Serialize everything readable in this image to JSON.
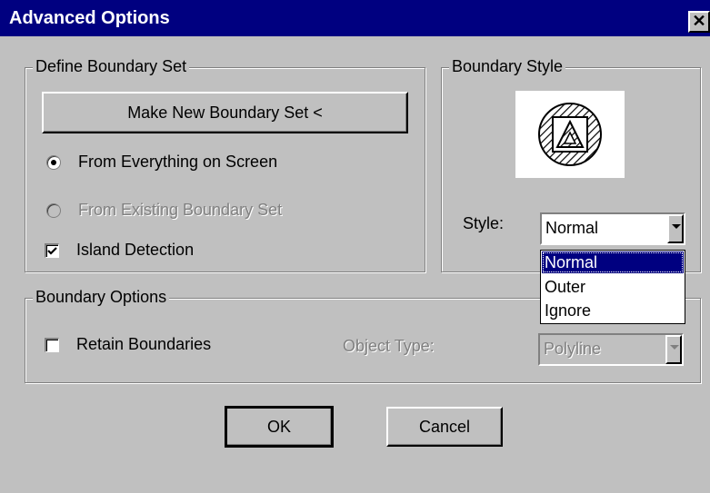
{
  "window": {
    "title": "Advanced Options",
    "close_glyph": "✕"
  },
  "define_boundary_set": {
    "legend": "Define Boundary Set",
    "make_new_button": "Make New Boundary Set <",
    "from_everything": "From Everything on Screen",
    "from_existing": "From Existing Boundary Set",
    "island_detection": "Island Detection",
    "from_everything_selected": true,
    "island_detection_checked": true
  },
  "boundary_style": {
    "legend": "Boundary Style",
    "style_label": "Style:",
    "style_value": "Normal",
    "options": [
      "Normal",
      "Outer",
      "Ignore"
    ],
    "selected_option": "Normal"
  },
  "boundary_options": {
    "legend": "Boundary Options",
    "retain_boundaries": "Retain Boundaries",
    "retain_checked": false,
    "object_type_label": "Object Type:",
    "object_type_value": "Polyline"
  },
  "buttons": {
    "ok": "OK",
    "cancel": "Cancel"
  },
  "colors": {
    "title_bar": "#000080",
    "face": "#c0c0c0",
    "selection": "#000080"
  }
}
